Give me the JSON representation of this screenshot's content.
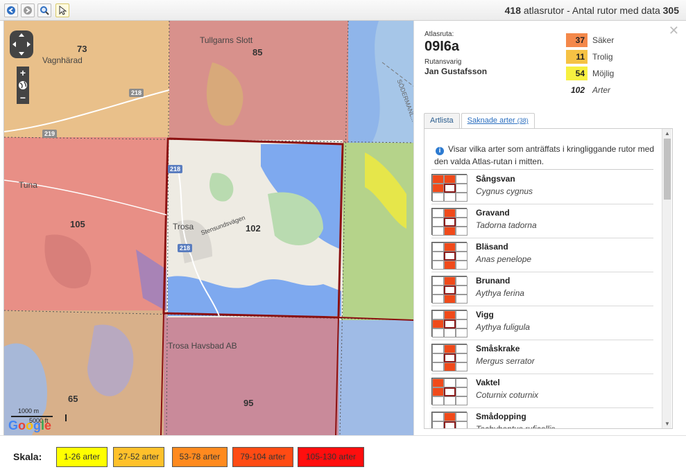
{
  "toolbar": {
    "icons": [
      "back-icon",
      "forward-icon",
      "zoom-icon",
      "pointer-icon"
    ],
    "title_count": "418",
    "title_text": " atlasrutor - Antal rutor med data ",
    "title_data": "305"
  },
  "map": {
    "numbers": {
      "n73": "73",
      "n85": "85",
      "n105": "105",
      "n102": "102",
      "n65": "65",
      "n95": "95"
    },
    "places": {
      "vagnharad": "Vagnhärad",
      "tullgarn": "Tullgarns Slott",
      "tuna": "Tuna",
      "trosa": "Trosa",
      "stensund": "Stensundsvägen",
      "havsbad": "Trosa Havsbad AB",
      "sodermanland": "SÖDERMANL..."
    },
    "roads": {
      "r218a": "218",
      "r219": "219",
      "r218b": "218",
      "r218c": "218"
    },
    "scale": {
      "metric": "1000 m",
      "imperial": "5000 ft"
    },
    "google": "Google"
  },
  "panel": {
    "atlas_label": "Atlasruta:",
    "atlas_code": "09I6a",
    "resp_label": "Rutansvarig",
    "resp_name": "Jan Gustafsson",
    "stats": [
      {
        "value": "37",
        "label": "Säker",
        "color": "#f4884a"
      },
      {
        "value": "11",
        "label": "Trolig",
        "color": "#f6c244"
      },
      {
        "value": "54",
        "label": "Möjlig",
        "color": "#f7f040"
      },
      {
        "value": "102",
        "label": "Arter",
        "color": ""
      }
    ],
    "tabs": [
      {
        "label": "Artlista",
        "count": ""
      },
      {
        "label": "Saknade arter",
        "count": "(38)"
      }
    ],
    "info": "Visar vilka arter som anträffats i kringliggande rutor med den valda Atlas-rutan i mitten.",
    "species": [
      {
        "name": "Sångsvan",
        "latin": "Cygnus cygnus",
        "cells": [
          1,
          1,
          0,
          1,
          0,
          0,
          0,
          0,
          0
        ]
      },
      {
        "name": "Gravand",
        "latin": "Tadorna tadorna",
        "cells": [
          0,
          1,
          0,
          0,
          0,
          0,
          0,
          1,
          0
        ]
      },
      {
        "name": "Bläsand",
        "latin": "Anas penelope",
        "cells": [
          0,
          1,
          0,
          0,
          0,
          0,
          0,
          1,
          0
        ]
      },
      {
        "name": "Brunand",
        "latin": "Aythya ferina",
        "cells": [
          0,
          1,
          0,
          0,
          0,
          0,
          0,
          1,
          0
        ]
      },
      {
        "name": "Vigg",
        "latin": "Aythya fuligula",
        "cells": [
          0,
          1,
          0,
          1,
          0,
          0,
          0,
          0,
          0
        ]
      },
      {
        "name": "Småskrake",
        "latin": "Mergus serrator",
        "cells": [
          0,
          1,
          0,
          0,
          0,
          0,
          0,
          1,
          0
        ]
      },
      {
        "name": "Vaktel",
        "latin": "Coturnix coturnix",
        "cells": [
          1,
          0,
          0,
          1,
          0,
          0,
          0,
          0,
          0
        ]
      },
      {
        "name": "Smådopping",
        "latin": "Tachybaptus ruficollis",
        "cells": [
          0,
          1,
          0,
          0,
          0,
          0,
          0,
          1,
          0
        ]
      }
    ]
  },
  "legend": {
    "title": "Skala:",
    "items": [
      {
        "label": "1-26 arter",
        "color": "#ffff00"
      },
      {
        "label": "27-52 arter",
        "color": "#ffc12b"
      },
      {
        "label": "53-78 arter",
        "color": "#ff8a1f"
      },
      {
        "label": "79-104 arter",
        "color": "#ff4b14"
      },
      {
        "label": "105-130 arter",
        "color": "#ff0e0e"
      }
    ]
  }
}
